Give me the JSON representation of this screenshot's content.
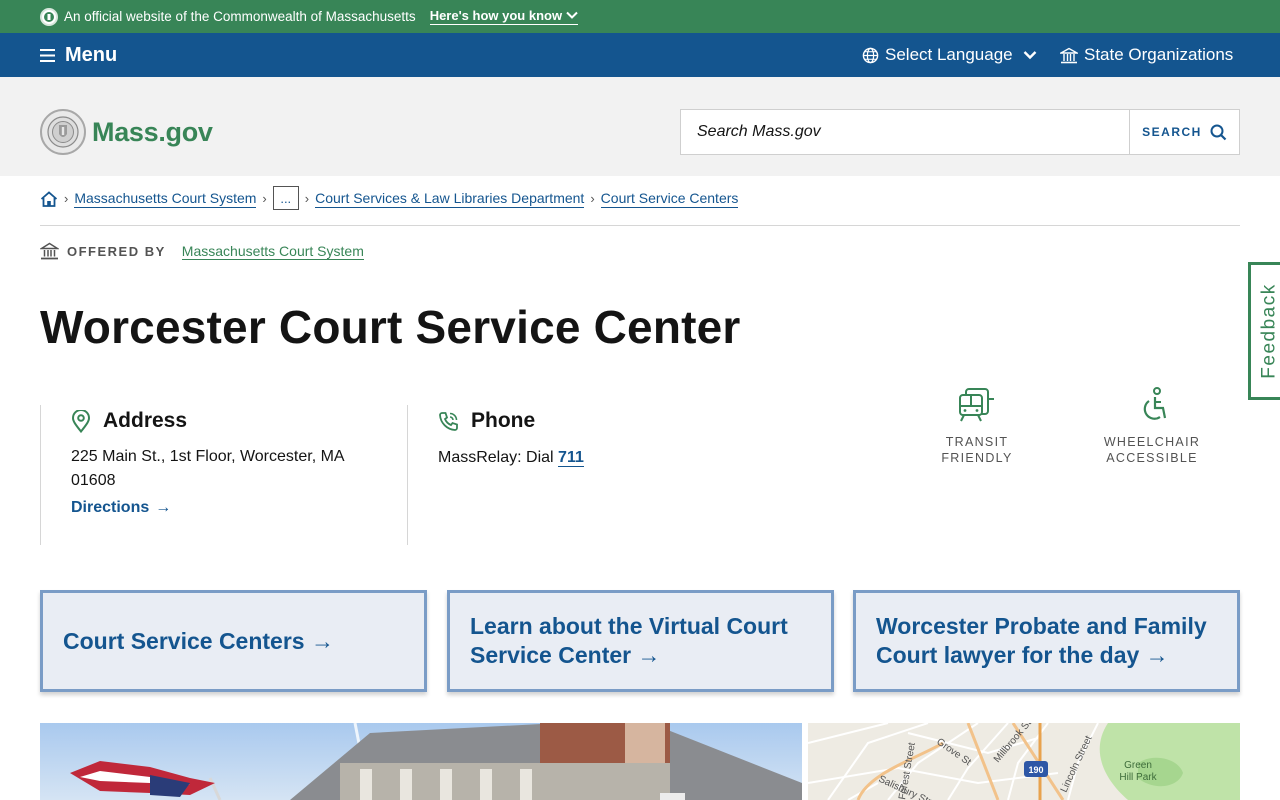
{
  "official_banner": {
    "text": "An official website of the Commonwealth of Massachusetts",
    "how_link": "Here's how you know"
  },
  "navbar": {
    "menu_label": "Menu",
    "language_label": "Select Language",
    "state_orgs_label": "State Organizations"
  },
  "header": {
    "logo_text": "Mass.gov",
    "search_placeholder": "Search Mass.gov",
    "search_button": "SEARCH"
  },
  "breadcrumb": {
    "items": [
      "Massachusetts Court System",
      "...",
      "Court Services & Law Libraries Department",
      "Court Service Centers"
    ]
  },
  "offered_by": {
    "label": "OFFERED BY",
    "org": "Massachusetts Court System"
  },
  "page_title": "Worcester Court Service Center",
  "address": {
    "heading": "Address",
    "text": "225 Main St., 1st Floor, Worcester, MA 01608",
    "directions": "Directions"
  },
  "phone": {
    "heading": "Phone",
    "prefix": "MassRelay: Dial",
    "number": "711"
  },
  "features": [
    {
      "line1": "TRANSIT",
      "line2": "FRIENDLY",
      "icon": "tram-icon"
    },
    {
      "line1": "WHEELCHAIR",
      "line2": "ACCESSIBLE",
      "icon": "wheelchair-icon"
    }
  ],
  "cards": [
    {
      "label": "Court Service Centers"
    },
    {
      "label": "Learn about the Virtual Court Service Center"
    },
    {
      "label": "Worcester Probate and Family Court lawyer for the day"
    }
  ],
  "feedback_label": "Feedback",
  "map_labels": {
    "grove": "Grove St",
    "millbrook": "Millbrook Street",
    "lincoln": "Lincoln Street",
    "forest": "Forest Street",
    "salisbury": "Salisbury Street",
    "highway": "190",
    "park": "Green Hill Park"
  },
  "colors": {
    "green": "#388557",
    "blue": "#14558f",
    "card_bg": "#e9edf4",
    "card_border": "#7a9cc6"
  }
}
